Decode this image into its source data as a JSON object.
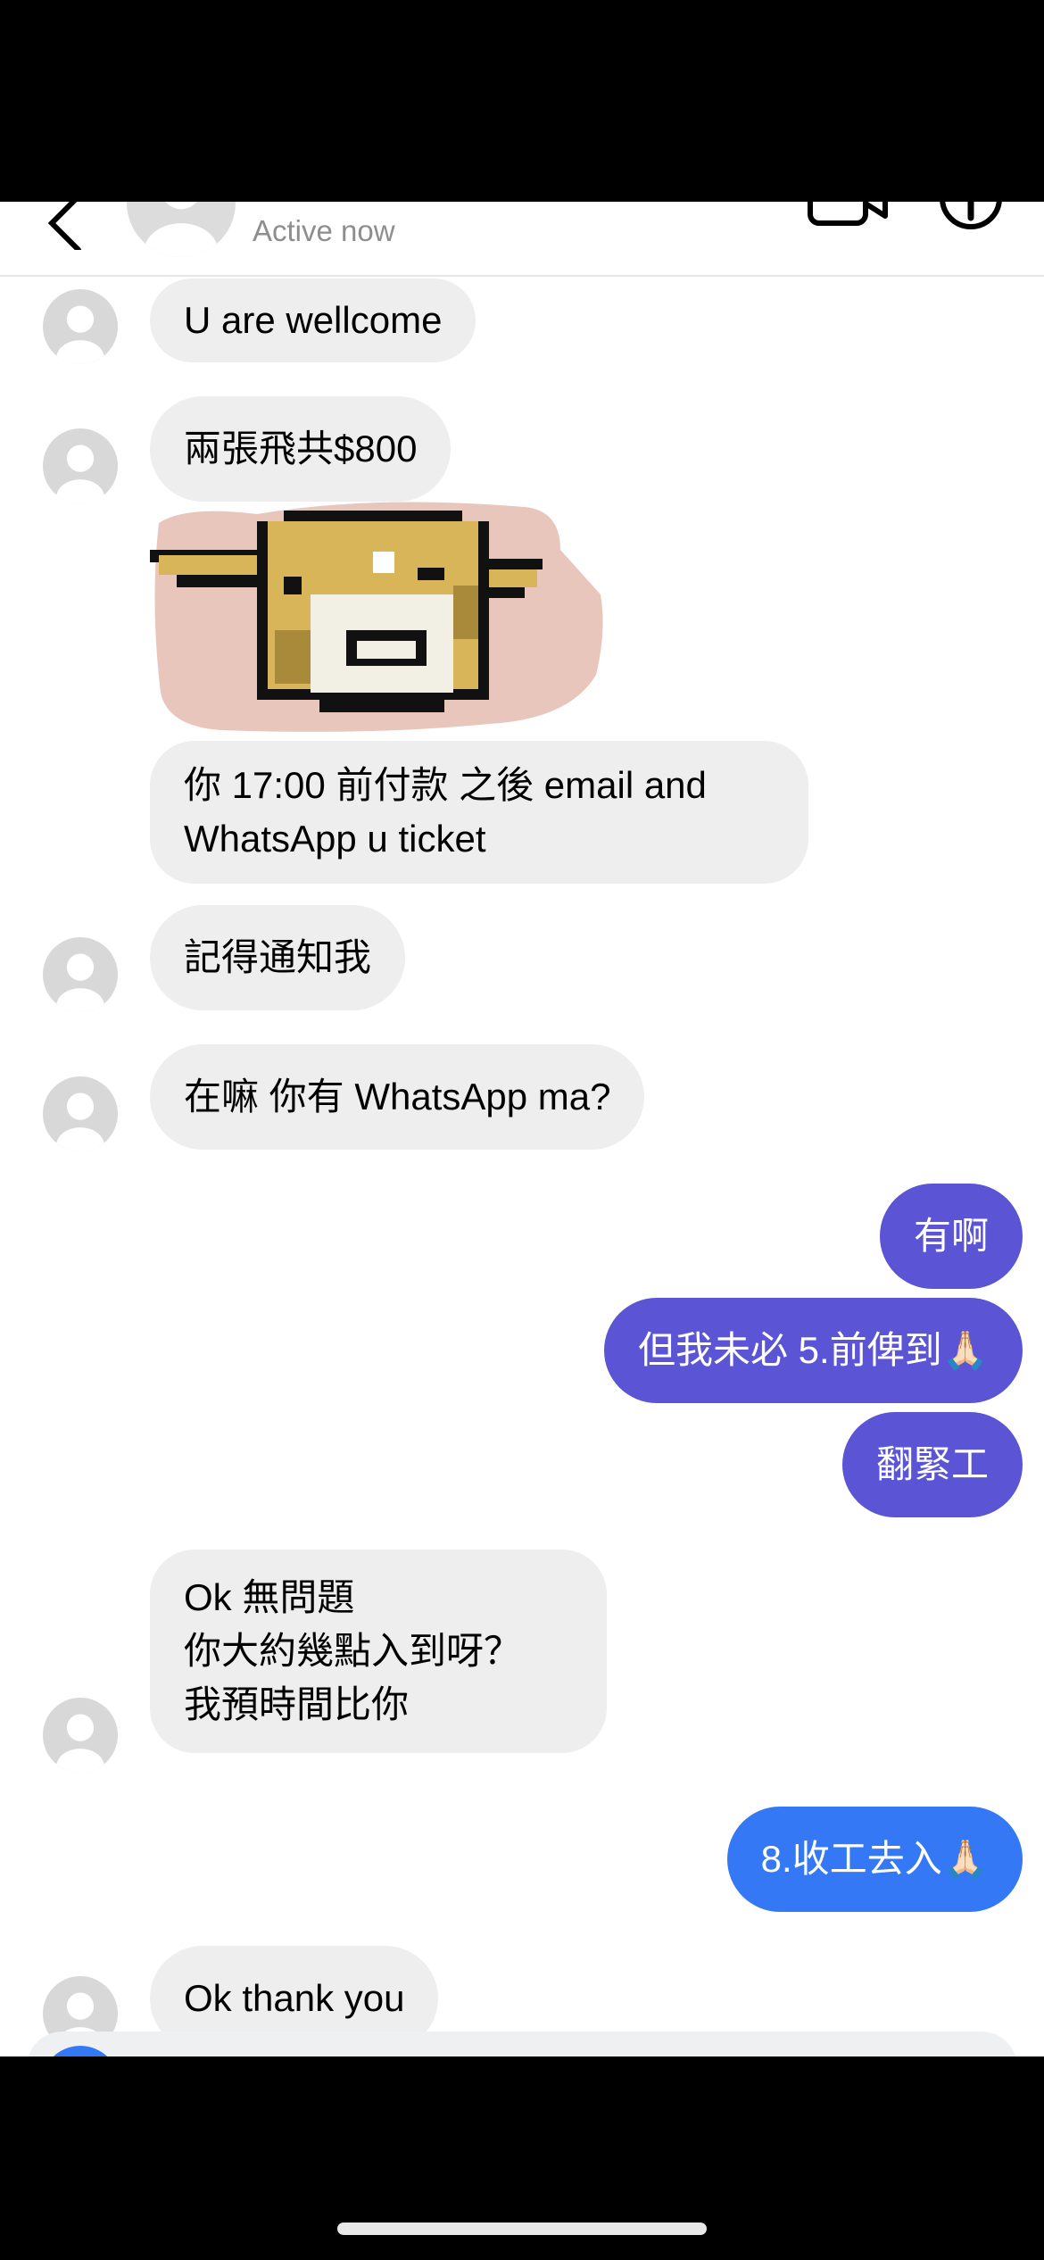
{
  "header": {
    "status": "Active now"
  },
  "messages": [
    {
      "side": "in",
      "text": "U are wellcome"
    },
    {
      "side": "in",
      "text": "兩張飛共$800"
    },
    {
      "side": "in",
      "type": "sticker",
      "icon": "pixel-dog-sticker"
    },
    {
      "side": "in",
      "text": "你 17:00 前付款 之後 email and\nWhatsApp u ticket"
    },
    {
      "side": "in",
      "text": "記得通知我"
    },
    {
      "side": "in",
      "text": "在嘛 你有 WhatsApp ma?"
    },
    {
      "side": "out",
      "text": "有啊"
    },
    {
      "side": "out",
      "text": "但我未必 5.前俾到🙏🏻"
    },
    {
      "side": "out",
      "text": "翻緊工"
    },
    {
      "side": "in",
      "text": "Ok 無問題\n你大約幾點入到呀？\n我預時間比你"
    },
    {
      "side": "out",
      "text": "8.收工去入🙏🏻"
    },
    {
      "side": "in",
      "text": "Ok thank you"
    }
  ],
  "colors": {
    "incoming_bubble": "#eeeeee",
    "outgoing_bubble": "#5b55d6",
    "outgoing_bubble_latest": "#3478f6",
    "status_text": "#8e8e8e"
  }
}
